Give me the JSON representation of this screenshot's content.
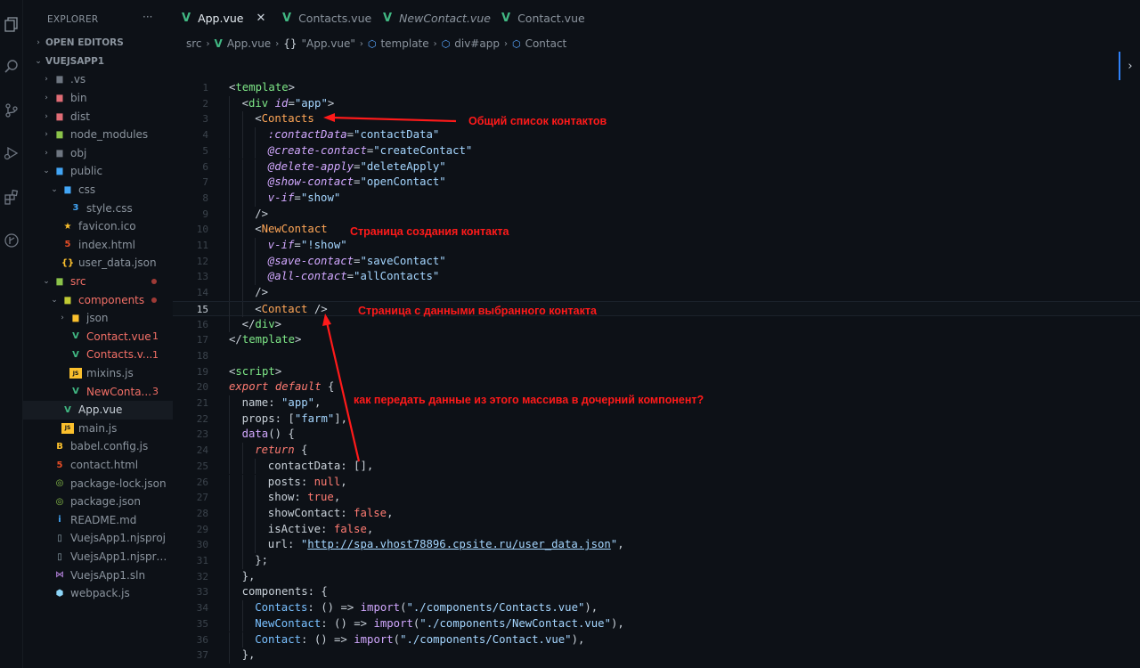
{
  "sidebar": {
    "title": "EXPLORER",
    "more": "···",
    "items": [
      {
        "label": "OPEN EDITORS",
        "type": "section",
        "depth": 0,
        "chev": "›",
        "icon": "",
        "color": ""
      },
      {
        "label": "VUEJSAPP1",
        "type": "section",
        "depth": 0,
        "chev": "⌄",
        "icon": "",
        "color": ""
      },
      {
        "label": ".vs",
        "type": "folder",
        "depth": 1,
        "chev": "›",
        "icon": "folder-icon",
        "color": "#6e7681"
      },
      {
        "label": "bin",
        "type": "folder",
        "depth": 1,
        "chev": "›",
        "icon": "folder-icon",
        "color": "#e06c75"
      },
      {
        "label": "dist",
        "type": "folder",
        "depth": 1,
        "chev": "›",
        "icon": "folder-icon",
        "color": "#e06c75"
      },
      {
        "label": "node_modules",
        "type": "folder",
        "depth": 1,
        "chev": "›",
        "icon": "folder-icon",
        "color": "#8bc34a"
      },
      {
        "label": "obj",
        "type": "folder",
        "depth": 1,
        "chev": "›",
        "icon": "folder-icon",
        "color": "#6e7681"
      },
      {
        "label": "public",
        "type": "folder",
        "depth": 1,
        "chev": "⌄",
        "icon": "folder-icon",
        "color": "#42a5f5"
      },
      {
        "label": "css",
        "type": "folder",
        "depth": 2,
        "chev": "⌄",
        "icon": "folder-icon",
        "color": "#42a5f5"
      },
      {
        "label": "style.css",
        "type": "file",
        "depth": 3,
        "chev": "",
        "icon": "css-icon",
        "color": "#42a5f5"
      },
      {
        "label": "favicon.ico",
        "type": "file",
        "depth": 2,
        "chev": "",
        "icon": "star-icon",
        "color": "#fbc02d"
      },
      {
        "label": "index.html",
        "type": "file",
        "depth": 2,
        "chev": "",
        "icon": "html-icon",
        "color": "#e44d26"
      },
      {
        "label": "user_data.json",
        "type": "file",
        "depth": 2,
        "chev": "",
        "icon": "json-icon",
        "color": "#fbc02d"
      },
      {
        "label": "src",
        "type": "folder",
        "depth": 1,
        "chev": "⌄",
        "icon": "folder-icon",
        "color": "#8bc34a",
        "err": true,
        "dot": true
      },
      {
        "label": "components",
        "type": "folder",
        "depth": 2,
        "chev": "⌄",
        "icon": "folder-icon",
        "color": "#c0ca33",
        "err": true,
        "dot": true
      },
      {
        "label": "json",
        "type": "folder",
        "depth": 3,
        "chev": "›",
        "icon": "folder-icon",
        "color": "#fbc02d"
      },
      {
        "label": "Contact.vue",
        "type": "file",
        "depth": 3,
        "chev": "",
        "icon": "vue-icon",
        "color": "#41b883",
        "err": true,
        "badge": "1"
      },
      {
        "label": "Contacts.vue",
        "type": "file",
        "depth": 3,
        "chev": "",
        "icon": "vue-icon",
        "color": "#41b883",
        "err": true,
        "badge": "1",
        "short": "Contacts.v..."
      },
      {
        "label": "mixins.js",
        "type": "file",
        "depth": 3,
        "chev": "",
        "icon": "js-icon",
        "color": "#fbc02d"
      },
      {
        "label": "NewContact.vue",
        "type": "file",
        "depth": 3,
        "chev": "",
        "icon": "vue-icon",
        "color": "#41b883",
        "err": true,
        "badge": "3",
        "short": "NewConta..."
      },
      {
        "label": "App.vue",
        "type": "file",
        "depth": 2,
        "chev": "",
        "icon": "vue-icon",
        "color": "#41b883",
        "selected": true
      },
      {
        "label": "main.js",
        "type": "file",
        "depth": 2,
        "chev": "",
        "icon": "js-icon",
        "color": "#fbc02d"
      },
      {
        "label": "babel.config.js",
        "type": "file",
        "depth": 1,
        "chev": "",
        "icon": "babel-icon",
        "color": "#fbc02d"
      },
      {
        "label": "contact.html",
        "type": "file",
        "depth": 1,
        "chev": "",
        "icon": "html-icon",
        "color": "#e44d26"
      },
      {
        "label": "package-lock.json",
        "type": "file",
        "depth": 1,
        "chev": "",
        "icon": "npm-icon",
        "color": "#8bc34a"
      },
      {
        "label": "package.json",
        "type": "file",
        "depth": 1,
        "chev": "",
        "icon": "npm-icon",
        "color": "#8bc34a"
      },
      {
        "label": "README.md",
        "type": "file",
        "depth": 1,
        "chev": "",
        "icon": "info-icon",
        "color": "#42a5f5"
      },
      {
        "label": "VuejsApp1.njsproj",
        "type": "file",
        "depth": 1,
        "chev": "",
        "icon": "file-icon",
        "color": "#90a4ae"
      },
      {
        "label": "VuejsApp1.njsproj...",
        "type": "file",
        "depth": 1,
        "chev": "",
        "icon": "file-icon",
        "color": "#90a4ae"
      },
      {
        "label": "VuejsApp1.sln",
        "type": "file",
        "depth": 1,
        "chev": "",
        "icon": "vs-icon",
        "color": "#a074c4"
      },
      {
        "label": "webpack.js",
        "type": "file",
        "depth": 1,
        "chev": "",
        "icon": "webpack-icon",
        "color": "#8dd6f9"
      }
    ]
  },
  "tabs": [
    {
      "label": "App.vue",
      "active": true,
      "italic": false,
      "close": "✕"
    },
    {
      "label": "Contacts.vue",
      "active": false,
      "italic": false
    },
    {
      "label": "NewContact.vue",
      "active": false,
      "italic": true
    },
    {
      "label": "Contact.vue",
      "active": false,
      "italic": false
    }
  ],
  "breadcrumb": {
    "src": "src",
    "file": "App.vue",
    "obj": "\"App.vue\"",
    "template": "template",
    "div": "div#app",
    "comp": "Contact"
  },
  "editor": {
    "current_line": 15,
    "lines": [
      {
        "n": 1,
        "indent": 0,
        "tokens": [
          [
            "t-br",
            "<"
          ],
          [
            "t-tag",
            "template"
          ],
          [
            "t-br",
            ">"
          ]
        ]
      },
      {
        "n": 2,
        "indent": 1,
        "tokens": [
          [
            "t-br",
            "<"
          ],
          [
            "t-tag",
            "div "
          ],
          [
            "t-attr",
            "id"
          ],
          [
            "t-plain",
            "="
          ],
          [
            "t-str",
            "\"app\""
          ],
          [
            "t-br",
            ">"
          ]
        ]
      },
      {
        "n": 3,
        "indent": 2,
        "tokens": [
          [
            "t-br",
            "<"
          ],
          [
            "t-tagw",
            "Contacts"
          ]
        ]
      },
      {
        "n": 4,
        "indent": 3,
        "tokens": [
          [
            "t-attr",
            ":contactData"
          ],
          [
            "t-plain",
            "="
          ],
          [
            "t-str",
            "\"contactData\""
          ]
        ]
      },
      {
        "n": 5,
        "indent": 3,
        "tokens": [
          [
            "t-attr",
            "@create-contact"
          ],
          [
            "t-plain",
            "="
          ],
          [
            "t-str",
            "\"createContact\""
          ]
        ]
      },
      {
        "n": 6,
        "indent": 3,
        "tokens": [
          [
            "t-attr",
            "@delete-apply"
          ],
          [
            "t-plain",
            "="
          ],
          [
            "t-str",
            "\"deleteApply\""
          ]
        ]
      },
      {
        "n": 7,
        "indent": 3,
        "tokens": [
          [
            "t-attr",
            "@show-contact"
          ],
          [
            "t-plain",
            "="
          ],
          [
            "t-str",
            "\"openContact\""
          ]
        ]
      },
      {
        "n": 8,
        "indent": 3,
        "tokens": [
          [
            "t-attr",
            "v-if"
          ],
          [
            "t-plain",
            "="
          ],
          [
            "t-str",
            "\"show\""
          ]
        ]
      },
      {
        "n": 9,
        "indent": 2,
        "tokens": [
          [
            "t-br",
            "/>"
          ]
        ]
      },
      {
        "n": 10,
        "indent": 2,
        "tokens": [
          [
            "t-br",
            "<"
          ],
          [
            "t-tagw",
            "NewContact"
          ]
        ]
      },
      {
        "n": 11,
        "indent": 3,
        "tokens": [
          [
            "t-attr",
            "v-if"
          ],
          [
            "t-plain",
            "="
          ],
          [
            "t-str",
            "\"!show\""
          ]
        ]
      },
      {
        "n": 12,
        "indent": 3,
        "tokens": [
          [
            "t-attr",
            "@save-contact"
          ],
          [
            "t-plain",
            "="
          ],
          [
            "t-str",
            "\"saveContact\""
          ]
        ]
      },
      {
        "n": 13,
        "indent": 3,
        "tokens": [
          [
            "t-attr",
            "@all-contact"
          ],
          [
            "t-plain",
            "="
          ],
          [
            "t-str",
            "\"allContacts\""
          ]
        ]
      },
      {
        "n": 14,
        "indent": 2,
        "tokens": [
          [
            "t-br",
            "/>"
          ]
        ]
      },
      {
        "n": 15,
        "indent": 2,
        "tokens": [
          [
            "t-br",
            "<"
          ],
          [
            "t-tagw",
            "Contact "
          ],
          [
            "t-br",
            "/>"
          ]
        ]
      },
      {
        "n": 16,
        "indent": 1,
        "tokens": [
          [
            "t-br",
            "</"
          ],
          [
            "t-tag",
            "div"
          ],
          [
            "t-br",
            ">"
          ]
        ]
      },
      {
        "n": 17,
        "indent": 0,
        "tokens": [
          [
            "t-br",
            "</"
          ],
          [
            "t-tag",
            "template"
          ],
          [
            "t-br",
            ">"
          ]
        ]
      },
      {
        "n": 18,
        "indent": 0,
        "tokens": []
      },
      {
        "n": 19,
        "indent": 0,
        "tokens": [
          [
            "t-br",
            "<"
          ],
          [
            "t-tag",
            "script"
          ],
          [
            "t-br",
            ">"
          ]
        ]
      },
      {
        "n": 20,
        "indent": 0,
        "tokens": [
          [
            "t-kw",
            "export default"
          ],
          [
            "t-plain",
            " {"
          ]
        ]
      },
      {
        "n": 21,
        "indent": 1,
        "tokens": [
          [
            "t-plain",
            "name: "
          ],
          [
            "t-str",
            "\"app\""
          ],
          [
            "t-plain",
            ","
          ]
        ]
      },
      {
        "n": 22,
        "indent": 1,
        "tokens": [
          [
            "t-plain",
            "props: ["
          ],
          [
            "t-str",
            "\"farm\""
          ],
          [
            "t-plain",
            "],"
          ]
        ]
      },
      {
        "n": 23,
        "indent": 1,
        "tokens": [
          [
            "t-func",
            "data"
          ],
          [
            "t-plain",
            "() {"
          ]
        ]
      },
      {
        "n": 24,
        "indent": 2,
        "tokens": [
          [
            "t-kw",
            "return"
          ],
          [
            "t-plain",
            " {"
          ]
        ]
      },
      {
        "n": 25,
        "indent": 3,
        "tokens": [
          [
            "t-plain",
            "contactData: [],"
          ]
        ]
      },
      {
        "n": 26,
        "indent": 3,
        "tokens": [
          [
            "t-plain",
            "posts: "
          ],
          [
            "t-bool",
            "null"
          ],
          [
            "t-plain",
            ","
          ]
        ]
      },
      {
        "n": 27,
        "indent": 3,
        "tokens": [
          [
            "t-plain",
            "show: "
          ],
          [
            "t-bool",
            "true"
          ],
          [
            "t-plain",
            ","
          ]
        ]
      },
      {
        "n": 28,
        "indent": 3,
        "tokens": [
          [
            "t-plain",
            "showContact: "
          ],
          [
            "t-bool",
            "false"
          ],
          [
            "t-plain",
            ","
          ]
        ]
      },
      {
        "n": 29,
        "indent": 3,
        "tokens": [
          [
            "t-plain",
            "isActive: "
          ],
          [
            "t-bool",
            "false"
          ],
          [
            "t-plain",
            ","
          ]
        ]
      },
      {
        "n": 30,
        "indent": 3,
        "tokens": [
          [
            "t-plain",
            "url: "
          ],
          [
            "t-str",
            "\""
          ],
          [
            "t-url",
            "http://spa.vhost78896.cpsite.ru/user_data.json"
          ],
          [
            "t-str",
            "\""
          ],
          [
            "t-plain",
            ","
          ]
        ]
      },
      {
        "n": 31,
        "indent": 2,
        "tokens": [
          [
            "t-plain",
            "};"
          ]
        ]
      },
      {
        "n": 32,
        "indent": 1,
        "tokens": [
          [
            "t-plain",
            "},"
          ]
        ]
      },
      {
        "n": 33,
        "indent": 1,
        "tokens": [
          [
            "t-plain",
            "components: {"
          ]
        ]
      },
      {
        "n": 34,
        "indent": 2,
        "tokens": [
          [
            "t-comp",
            "Contacts"
          ],
          [
            "t-plain",
            ": () => "
          ],
          [
            "t-func",
            "import"
          ],
          [
            "t-plain",
            "("
          ],
          [
            "t-str",
            "\"./components/Contacts.vue\""
          ],
          [
            "t-plain",
            "),"
          ]
        ]
      },
      {
        "n": 35,
        "indent": 2,
        "tokens": [
          [
            "t-comp",
            "NewContact"
          ],
          [
            "t-plain",
            ": () => "
          ],
          [
            "t-func",
            "import"
          ],
          [
            "t-plain",
            "("
          ],
          [
            "t-str",
            "\"./components/NewContact.vue\""
          ],
          [
            "t-plain",
            "),"
          ]
        ]
      },
      {
        "n": 36,
        "indent": 2,
        "tokens": [
          [
            "t-comp",
            "Contact"
          ],
          [
            "t-plain",
            ": () => "
          ],
          [
            "t-func",
            "import"
          ],
          [
            "t-plain",
            "("
          ],
          [
            "t-str",
            "\"./components/Contact.vue\""
          ],
          [
            "t-plain",
            "),"
          ]
        ]
      },
      {
        "n": 37,
        "indent": 1,
        "tokens": [
          [
            "t-plain",
            "},"
          ]
        ]
      }
    ]
  },
  "annotations": {
    "note1": "Общий список контактов",
    "note2": "Страница создания контакта",
    "note3": "Страница с данными выбранного контакта",
    "note4": "как передать данные из этого массива в дочерний компонент?",
    "color": "#ff1a1a"
  },
  "minimap_toggle": "›"
}
